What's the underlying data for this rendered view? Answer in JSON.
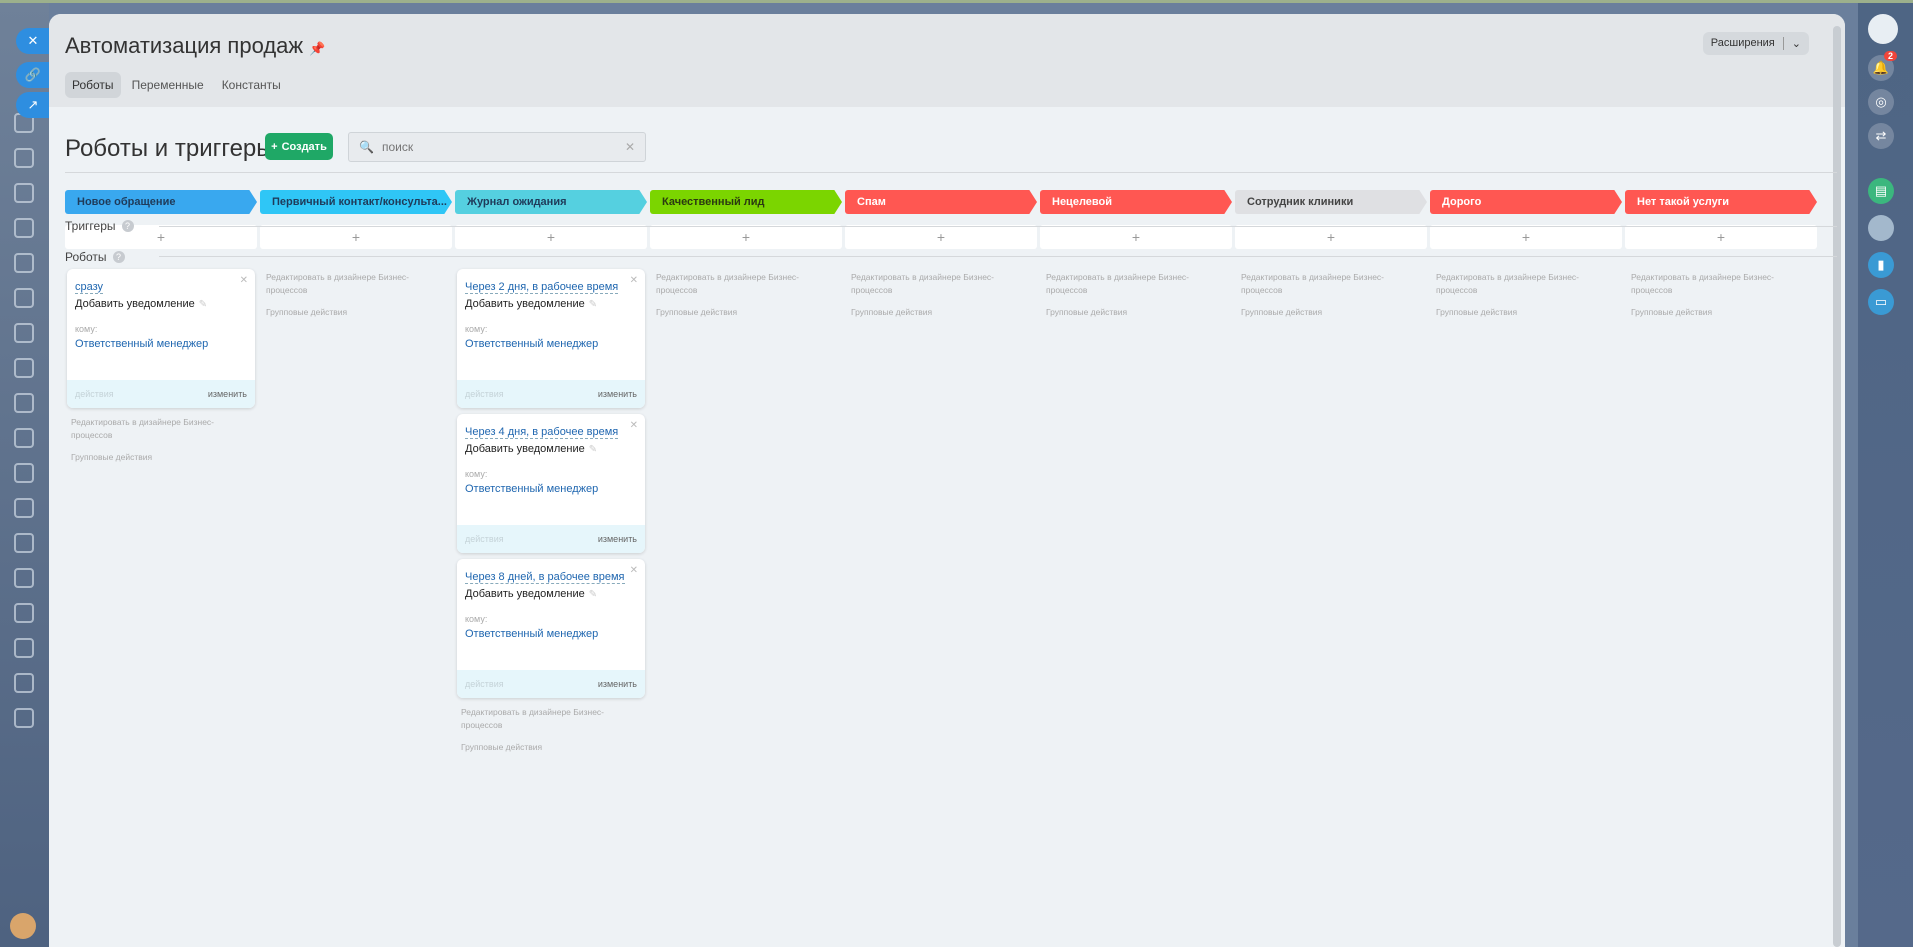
{
  "header": {
    "title": "Автоматизация продаж",
    "tabs": [
      "Роботы",
      "Переменные",
      "Константы"
    ],
    "extensions": "Расширения"
  },
  "toolbar": {
    "heading": "Роботы и триггеры",
    "create": "Создать",
    "search_placeholder": "поиск"
  },
  "sections": {
    "triggers": "Триггеры",
    "robots": "Роботы"
  },
  "notifications_count": "2",
  "stages": [
    {
      "label": "Новое обращение",
      "color": "#39a8ef",
      "text": "#1f3b5a"
    },
    {
      "label": "Первичный контакт/консульта...",
      "color": "#2fc6f6",
      "text": "#1f3b5a"
    },
    {
      "label": "Журнал ожидания",
      "color": "#55d0e0",
      "text": "#1f3b5a"
    },
    {
      "label": "Качественный лид",
      "color": "#7bd500",
      "text": "#2b3a10"
    },
    {
      "label": "Спам",
      "color": "#ff5752",
      "text": "#ffffff"
    },
    {
      "label": "Нецелевой",
      "color": "#ff5752",
      "text": "#ffffff"
    },
    {
      "label": "Сотрудник клиники",
      "color": "#dfe0e3",
      "text": "#444444"
    },
    {
      "label": "Дорого",
      "color": "#ff5752",
      "text": "#ffffff"
    },
    {
      "label": "Нет такой услуги",
      "color": "#ff5752",
      "text": "#ffffff"
    }
  ],
  "add_label": "+",
  "robots": [
    [
      {
        "delay": "сразу",
        "title": "Добавить уведомление",
        "to_label": "кому:",
        "to": "Ответственный менеджер",
        "actions": "действия",
        "edit": "изменить"
      }
    ],
    [],
    [
      {
        "delay": "Через 2 дня, в рабочее время",
        "title": "Добавить уведомление",
        "to_label": "кому:",
        "to": "Ответственный менеджер",
        "actions": "действия",
        "edit": "изменить"
      },
      {
        "delay": "Через 4 дня, в рабочее время",
        "title": "Добавить уведомление",
        "to_label": "кому:",
        "to": "Ответственный менеджер",
        "actions": "действия",
        "edit": "изменить"
      },
      {
        "delay": "Через 8 дней, в рабочее время",
        "title": "Добавить уведомление",
        "to_label": "кому:",
        "to": "Ответственный менеджер",
        "actions": "действия",
        "edit": "изменить"
      }
    ],
    [],
    [],
    [],
    [],
    [],
    []
  ],
  "column_links": {
    "designer": "Редактировать в дизайнере Бизнес-процессов",
    "group": "Групповые действия"
  }
}
